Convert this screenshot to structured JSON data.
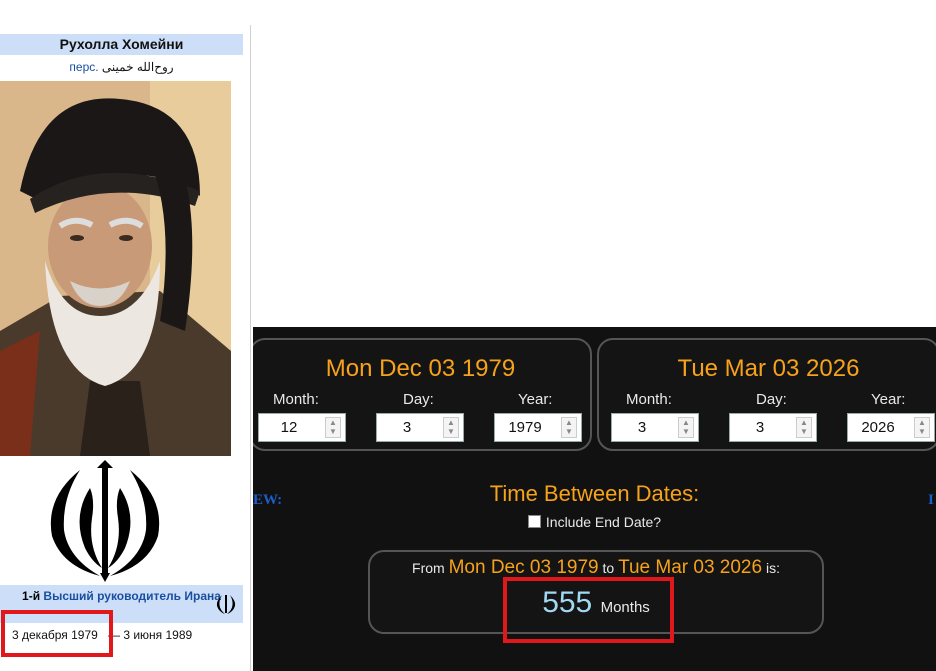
{
  "infobox": {
    "name": "Рухолла Хомейни",
    "native_lang_link": "перс.",
    "native_name": "روح‌الله خمینی",
    "role_prefix": "1-й",
    "role_link": "Высший руководитель Ирана",
    "term_start": "3 декабря 1979",
    "term_end": "— 3 июня 1989"
  },
  "calculator": {
    "from": {
      "title": "Mon Dec 03 1979",
      "month_label": "Month:",
      "month": "12",
      "day_label": "Day:",
      "day": "3",
      "year_label": "Year:",
      "year": "1979"
    },
    "to": {
      "title": "Tue Mar 03 2026",
      "month_label": "Month:",
      "month": "3",
      "day_label": "Day:",
      "day": "3",
      "year_label": "Year:",
      "year": "2026"
    },
    "side_left": "EW:",
    "side_right": "I",
    "between_title": "Time Between Dates:",
    "include_end_date": "Include End Date?",
    "result": {
      "from_word": "From",
      "from_date": "Mon Dec 03 1979",
      "to_word": "to",
      "to_date": "Tue Mar 03 2026",
      "is_word": "is:",
      "value": "555",
      "unit": "Months"
    }
  },
  "colors": {
    "accent": "#f6a21a",
    "result": "#9fd9f2",
    "highlight": "#e0181b",
    "infobox_header": "#cddff8"
  }
}
